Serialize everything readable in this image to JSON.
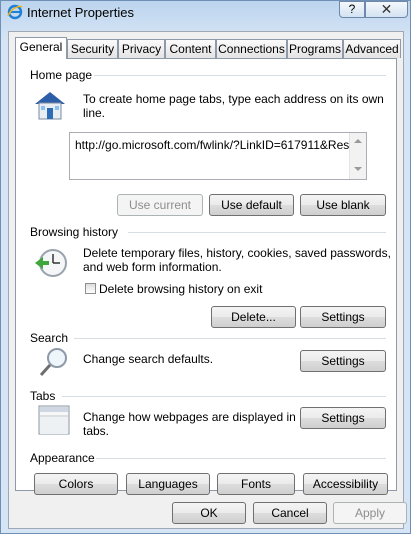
{
  "window": {
    "title": "Internet Properties",
    "help_label": "?",
    "close_label": "✕"
  },
  "tabs": [
    {
      "label": "General"
    },
    {
      "label": "Security"
    },
    {
      "label": "Privacy"
    },
    {
      "label": "Content"
    },
    {
      "label": "Connections"
    },
    {
      "label": "Programs"
    },
    {
      "label": "Advanced"
    }
  ],
  "home_page": {
    "title": "Home page",
    "description": "To create home page tabs, type each address on its own line.",
    "url": "http://go.microsoft.com/fwlink/?LinkID=617911&Res",
    "use_current": "Use current",
    "use_default": "Use default",
    "use_blank": "Use blank"
  },
  "browsing_history": {
    "title": "Browsing history",
    "description_line1": "Delete temporary files, history, cookies, saved passwords,",
    "description_line2": "and web form information.",
    "checkbox_label": "Delete browsing history on exit",
    "checkbox_checked": false,
    "delete_label": "Delete...",
    "settings_label": "Settings"
  },
  "search": {
    "title": "Search",
    "description": "Change search defaults.",
    "settings_label": "Settings"
  },
  "tabs_section": {
    "title": "Tabs",
    "description_line1": "Change how webpages are displayed in",
    "description_line2": "tabs.",
    "settings_label": "Settings"
  },
  "appearance": {
    "title": "Appearance",
    "colors_label": "Colors",
    "languages_label": "Languages",
    "fonts_label": "Fonts",
    "accessibility_label": "Accessibility"
  },
  "footer": {
    "ok_label": "OK",
    "cancel_label": "Cancel",
    "apply_label": "Apply"
  },
  "colors": {
    "accent": "#3a6fb5",
    "group_line": "#d5dfe5"
  }
}
